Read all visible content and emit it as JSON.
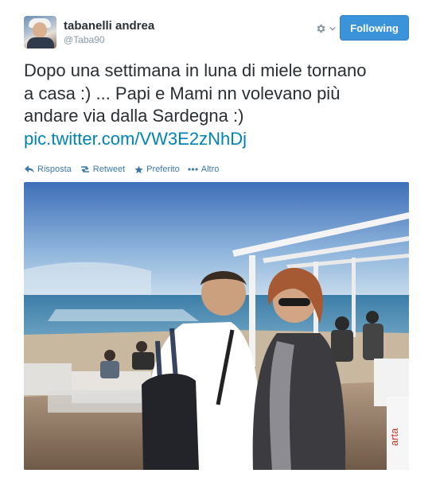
{
  "user": {
    "name": "tabanelli andrea",
    "handle": "@Taba90"
  },
  "header": {
    "follow_label": "Following",
    "settings_icon": "gear-icon"
  },
  "tweet": {
    "text_line1": "Dopo una settimana in luna di miele tornano",
    "text_line2": "a casa :) ... Papi e Mami nn volevano più",
    "text_line3": "andare via dalla Sardegna :)",
    "link": "pic.twitter.com/VW3E2zNhDj"
  },
  "actions": [
    {
      "label": "Risposta",
      "icon": "reply-icon"
    },
    {
      "label": "Retweet",
      "icon": "retweet-icon"
    },
    {
      "label": "Preferito",
      "icon": "star-icon"
    },
    {
      "label": "Altro",
      "icon": "more-icon"
    }
  ],
  "photo": {
    "sign_text": "arta"
  },
  "colors": {
    "follow_button": "#3b94d9",
    "link": "#0084b4",
    "action": "#3d78ad"
  }
}
